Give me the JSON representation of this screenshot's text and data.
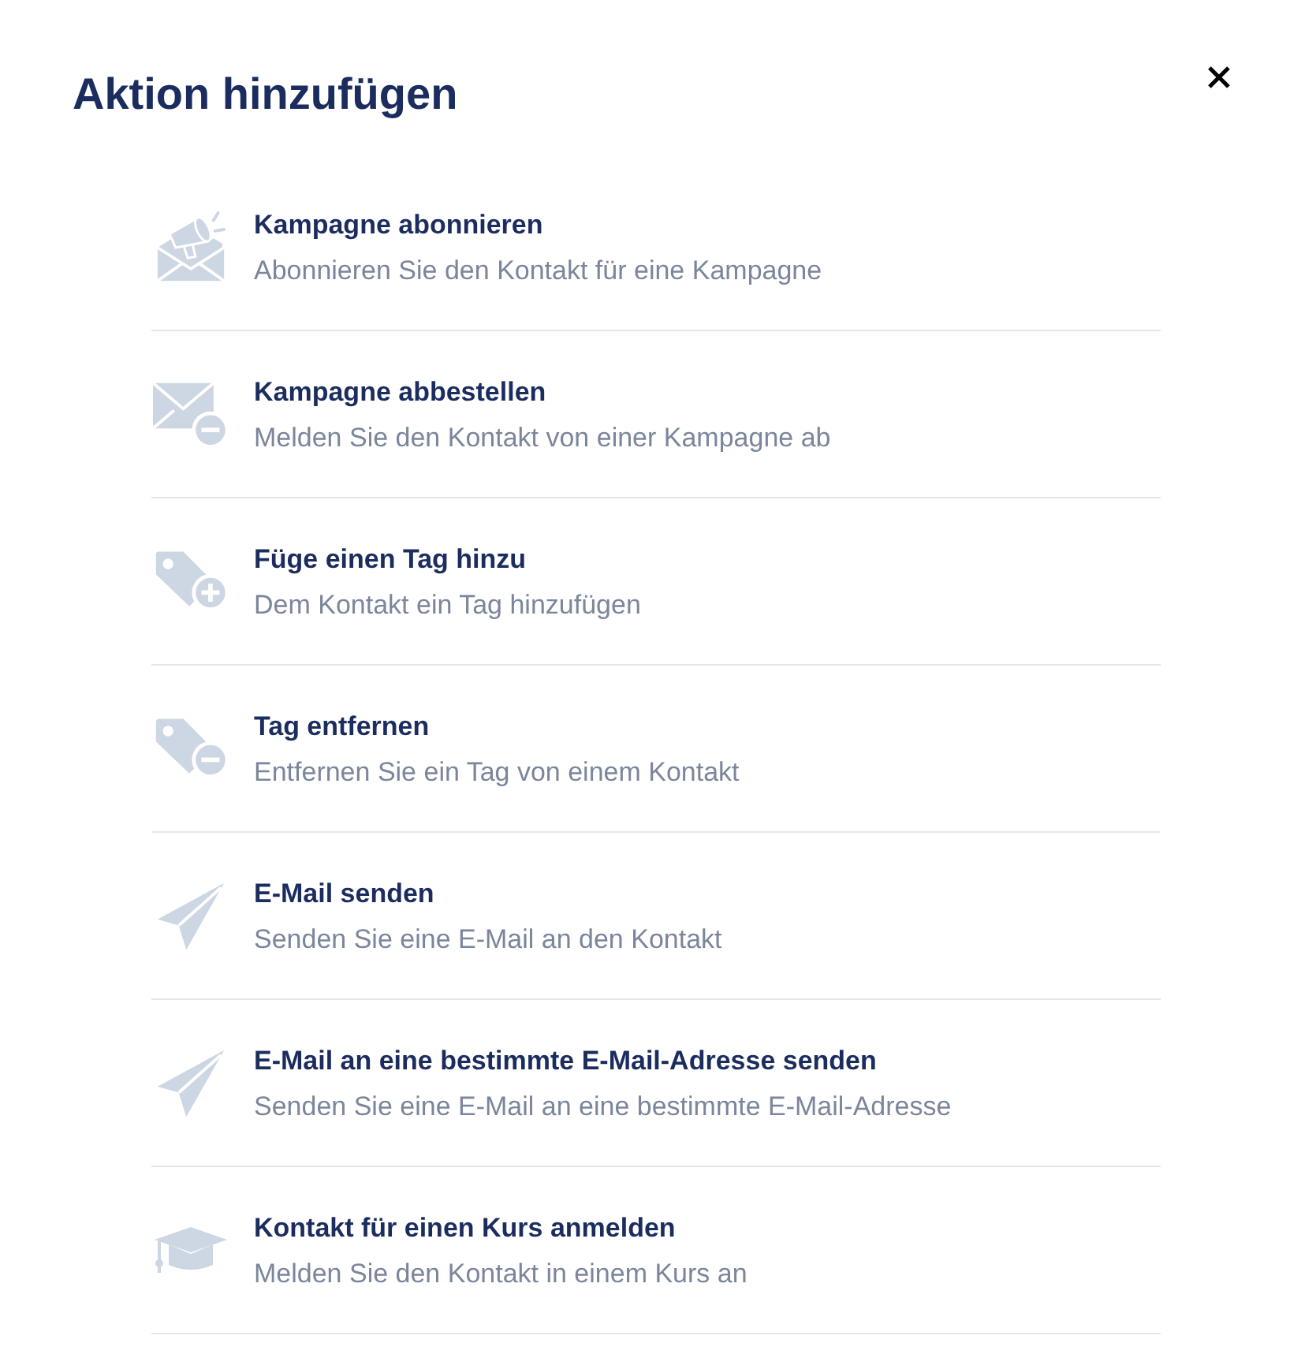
{
  "dialog": {
    "title": "Aktion hinzufügen"
  },
  "actions": [
    {
      "kind": "subscribe",
      "title": "Kampagne abonnieren",
      "description": "Abonnieren Sie den Kontakt für eine Kampagne"
    },
    {
      "kind": "unsubscribe",
      "title": "Kampagne abbestellen",
      "description": "Melden Sie den Kontakt von einer Kampagne ab"
    },
    {
      "kind": "tag-add",
      "title": "Füge einen Tag hinzu",
      "description": "Dem Kontakt ein Tag hinzufügen"
    },
    {
      "kind": "tag-remove",
      "title": "Tag entfernen",
      "description": "Entfernen Sie ein Tag von einem Kontakt"
    },
    {
      "kind": "email",
      "title": "E-Mail senden",
      "description": "Senden Sie eine E-Mail an den Kontakt"
    },
    {
      "kind": "email-address",
      "title": "E-Mail an eine bestimmte E-Mail-Adresse senden",
      "description": "Senden Sie eine E-Mail an eine bestimmte E-Mail-Adresse"
    },
    {
      "kind": "course",
      "title": "Kontakt für einen Kurs anmelden",
      "description": "Melden Sie den Kontakt in einem Kurs an"
    }
  ]
}
